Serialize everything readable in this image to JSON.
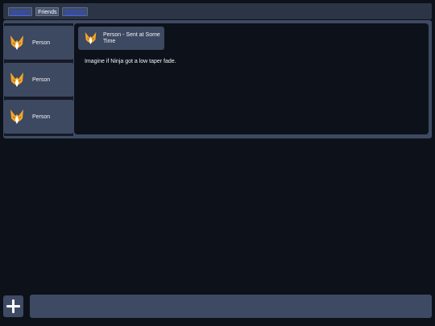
{
  "nav": {
    "tabs": [
      {
        "label": "Servers",
        "active": false
      },
      {
        "label": "Friends",
        "active": true
      },
      {
        "label": "Settings",
        "active": false
      }
    ]
  },
  "contacts": [
    {
      "name": "Person",
      "avatar_icon": "fox-avatar-icon"
    },
    {
      "name": "Person",
      "avatar_icon": "fox-avatar-icon"
    },
    {
      "name": "Person",
      "avatar_icon": "fox-avatar-icon"
    }
  ],
  "message": {
    "header": "Person - Sent at Some Time",
    "text": "Imagine if Ninja got a low taper fade."
  },
  "composer": {
    "value": "",
    "add_icon": "plus-icon"
  },
  "colors": {
    "background": "#0d111a",
    "panel": "#3e4a63",
    "card": "#3d4861",
    "link": "#2f4cf0"
  }
}
